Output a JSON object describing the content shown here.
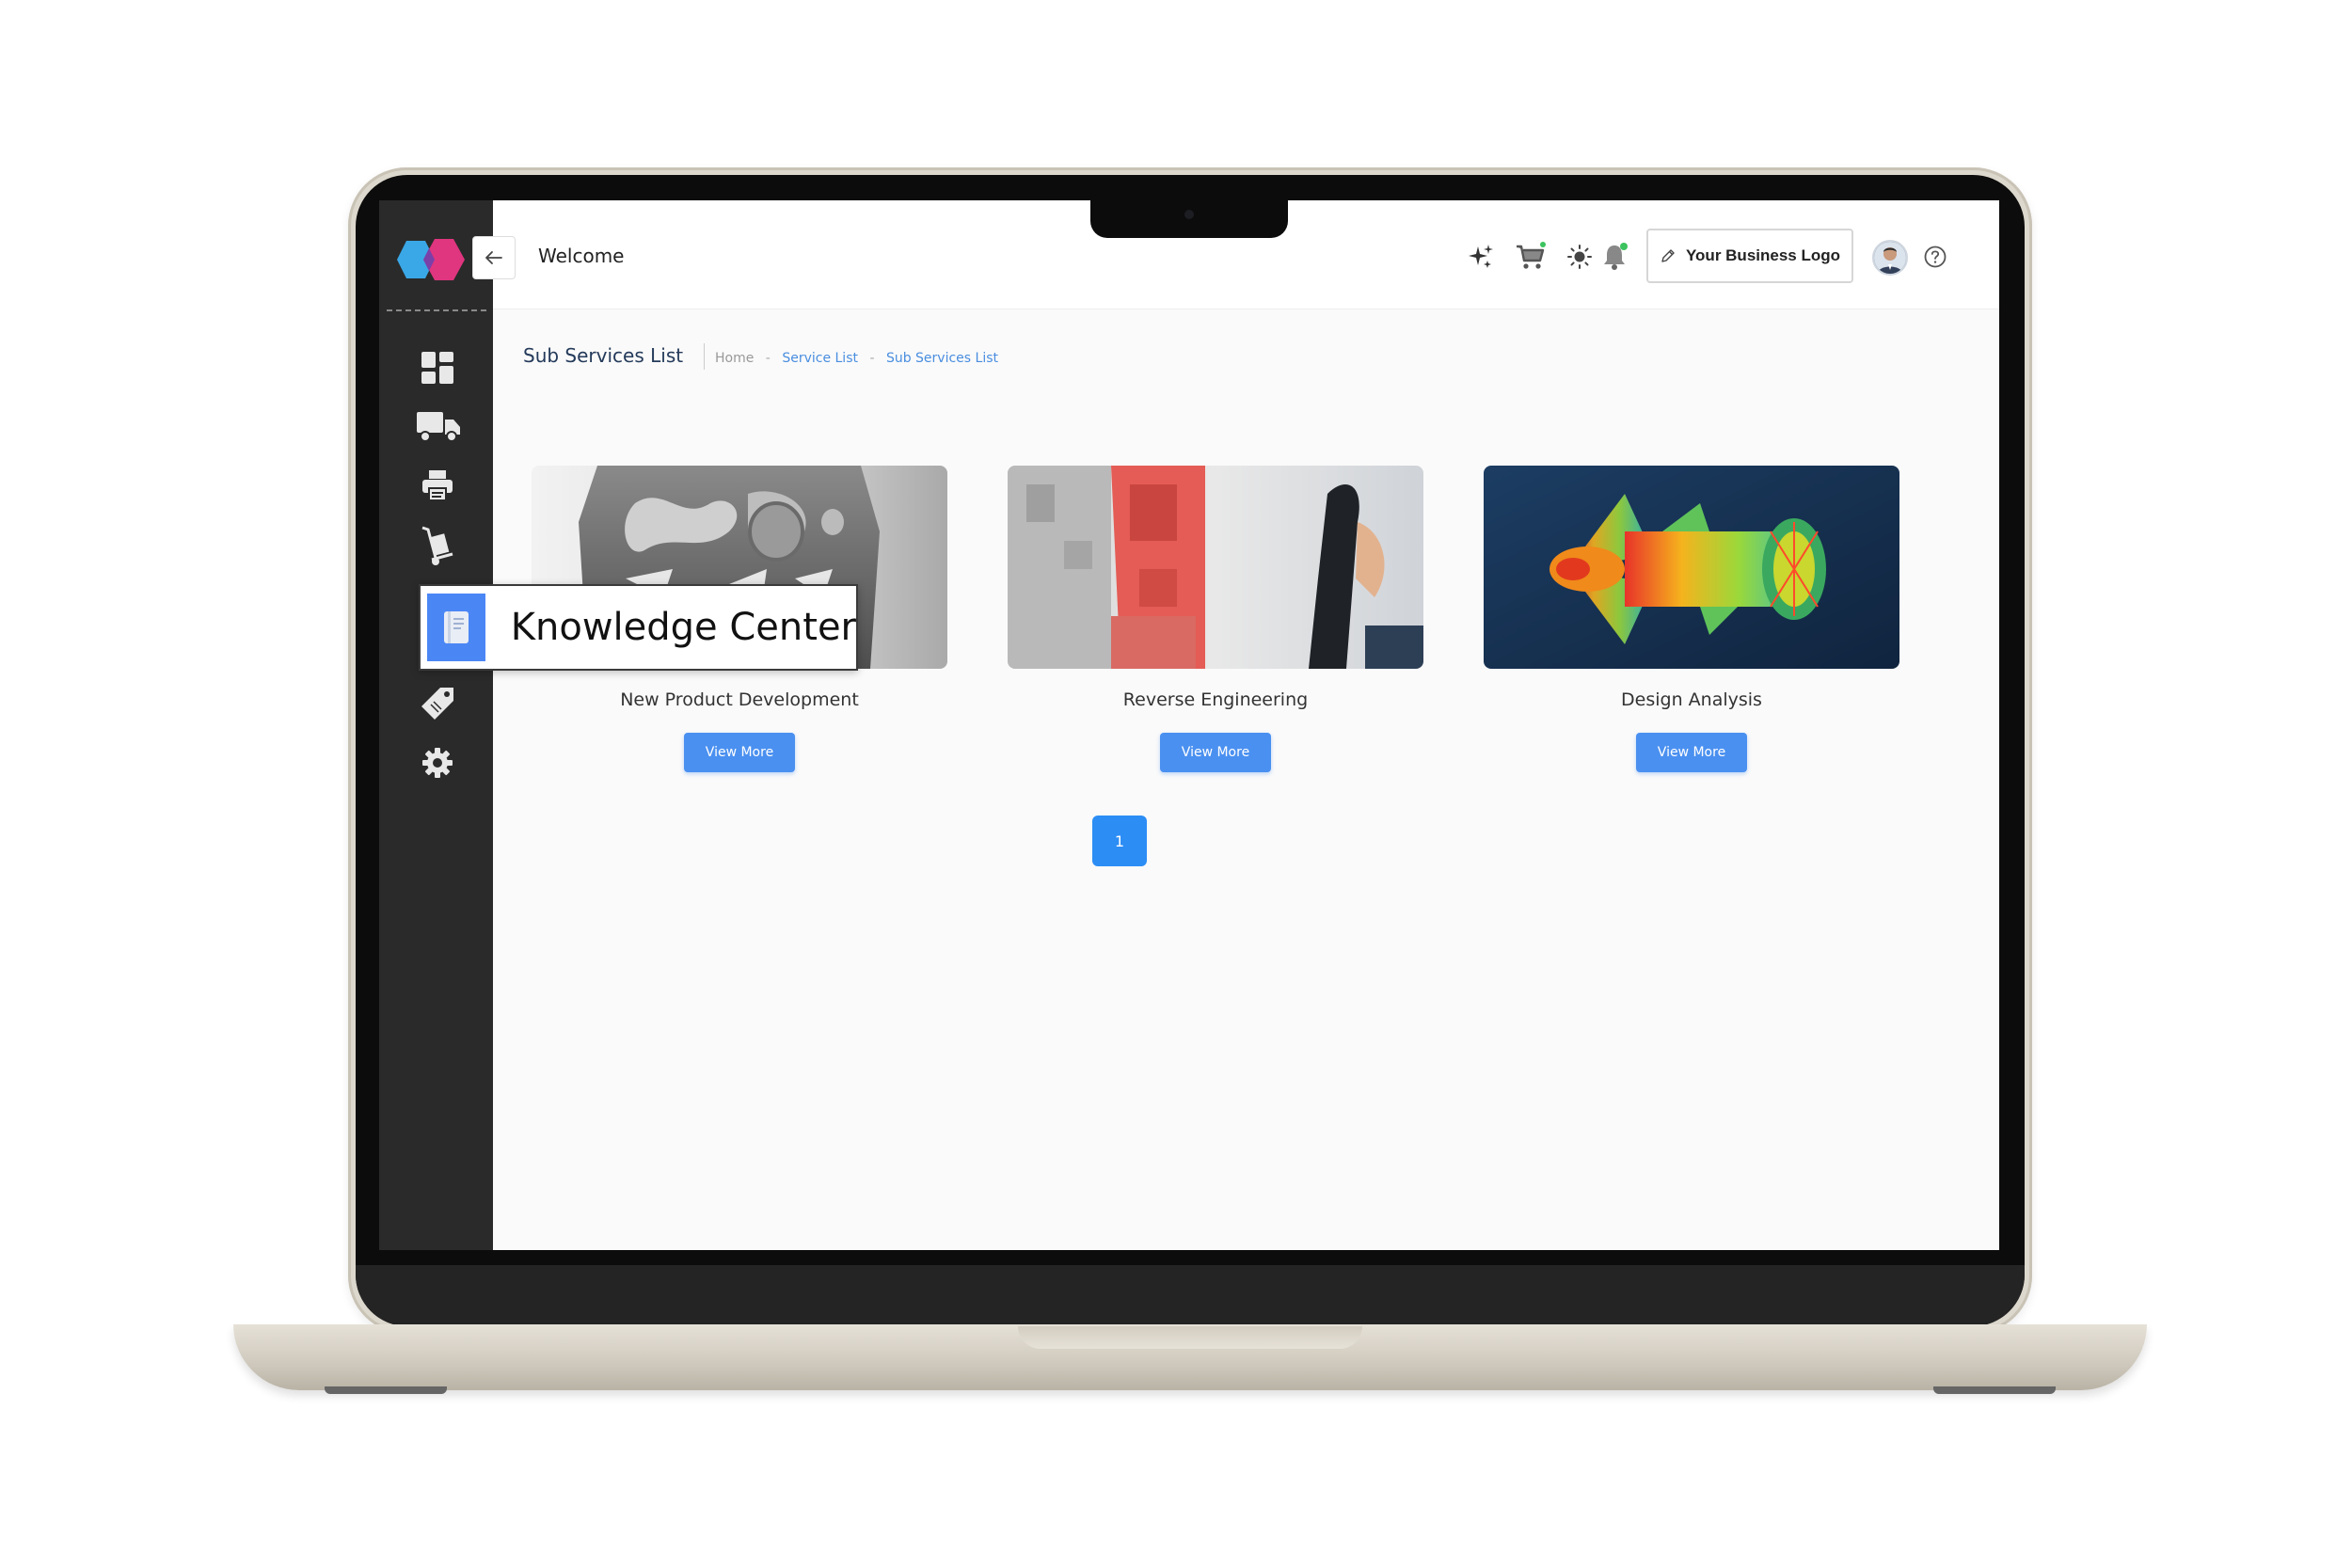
{
  "header": {
    "welcome_text": "Welcome",
    "business_logo_label": "Your Business Logo",
    "icons": [
      "sparkle-icon",
      "cart-icon",
      "sun-icon",
      "bell-icon",
      "avatar",
      "help-icon"
    ]
  },
  "sidebar": {
    "items": [
      {
        "icon": "dashboard-icon"
      },
      {
        "icon": "truck-icon"
      },
      {
        "icon": "printer-icon"
      },
      {
        "icon": "hand-truck-icon"
      },
      {
        "icon": "book-icon",
        "label": "Knowledge Center",
        "active": true
      },
      {
        "icon": "tag-icon"
      },
      {
        "icon": "gear-icon"
      }
    ]
  },
  "page": {
    "title": "Sub Services List",
    "breadcrumb": [
      "Home",
      "Service List",
      "Sub Services List"
    ]
  },
  "cards": [
    {
      "title": "New Product Development",
      "button": "View More"
    },
    {
      "title": "Reverse Engineering",
      "button": "View More"
    },
    {
      "title": "Design Analysis",
      "button": "View More"
    }
  ],
  "pagination": {
    "current": "1"
  },
  "colors": {
    "accent": "#4a90f0",
    "pagination": "#2c8df5",
    "sidebar": "#2a2a2a",
    "active_badge": "#4b86f5",
    "title_text": "#243a5a",
    "breadcrumb_link": "#4a8ee0"
  }
}
